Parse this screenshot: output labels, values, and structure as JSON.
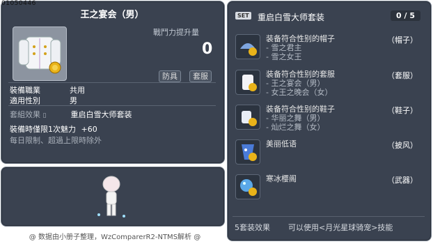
{
  "item": {
    "id": "01050446",
    "title": "王之宴会（男）",
    "stat_label": "戰鬥力提升量",
    "stat_value": "0",
    "tags": [
      "防具",
      "套服"
    ],
    "job_key": "裝備職業",
    "job_val": "共用",
    "gender_key": "適用性別",
    "gender_val": "男",
    "set_effect_key": "套組效果",
    "set_effect_val": "重启白雪大师套装",
    "limit_line": "裝備時僅限1次魅力",
    "limit_value": "+60",
    "limit_note": "每日限制、超過上限時除外"
  },
  "set": {
    "badge": "SET",
    "name": "重启白雪大师套装",
    "count": "0 / 5",
    "items": [
      {
        "title": "装备符合性别的帽子",
        "subs": [
          "- 雪之君主",
          "- 雪之女王"
        ],
        "slot": "（帽子）",
        "icon": "hat-icon"
      },
      {
        "title": "装备符合性别的套服",
        "subs": [
          "- 王之宴会（男）",
          "- 女王之晚会（女）"
        ],
        "slot": "（套服）",
        "icon": "outfit-icon"
      },
      {
        "title": "装备符合性别的鞋子",
        "subs": [
          "- 华丽之舞（男）",
          "- 灿烂之舞（女）"
        ],
        "slot": "（鞋子）",
        "icon": "shoes-icon"
      },
      {
        "title": "美丽低语",
        "subs": [],
        "slot": "（披风）",
        "icon": "cape-icon"
      },
      {
        "title": "寒冰樱阁",
        "subs": [],
        "slot": "（武器）",
        "icon": "weapon-icon"
      }
    ],
    "footer_left": "5套装效果",
    "footer_right": "可以使用<月光星球骑宠>技能"
  },
  "credit": "@ 数据由小册子整理，WzComparerR2-NTMS解析 @",
  "colors": {
    "panel": "#3a4250",
    "border": "#6e7886"
  }
}
